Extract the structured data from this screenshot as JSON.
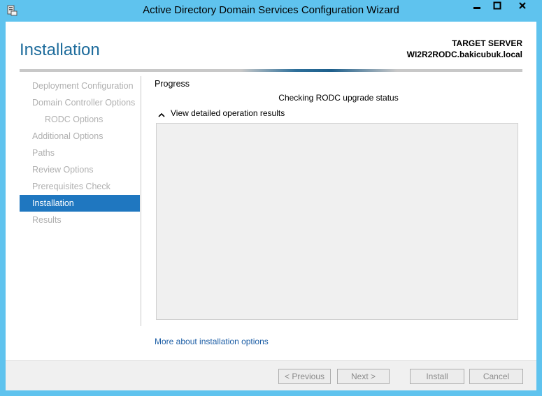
{
  "window": {
    "title": "Active Directory Domain Services Configuration Wizard",
    "icon": "server-manager-icon",
    "controls": [
      "minimize-icon",
      "maximize-icon",
      "close-icon"
    ]
  },
  "header": {
    "page_title": "Installation",
    "target_label": "TARGET SERVER",
    "target_name": "WI2R2RODC.bakicubuk.local"
  },
  "nav": {
    "items": [
      {
        "label": "Deployment Configuration"
      },
      {
        "label": "Domain Controller Options"
      },
      {
        "label": "RODC Options"
      },
      {
        "label": "Additional Options"
      },
      {
        "label": "Paths"
      },
      {
        "label": "Review Options"
      },
      {
        "label": "Prerequisites Check"
      },
      {
        "label": "Installation"
      },
      {
        "label": "Results"
      }
    ]
  },
  "content": {
    "heading": "Progress",
    "status": "Checking RODC upgrade status",
    "toggle_label": "View detailed operation results",
    "more_link": "More about installation options"
  },
  "footer": {
    "previous": "< Previous",
    "next": "Next >",
    "install": "Install",
    "cancel": "Cancel"
  },
  "colors": {
    "title_bar": "#5fc3ee",
    "accent_blue": "#1f77c0",
    "header_title": "#1e6c9c",
    "link": "#1e5fa6"
  }
}
